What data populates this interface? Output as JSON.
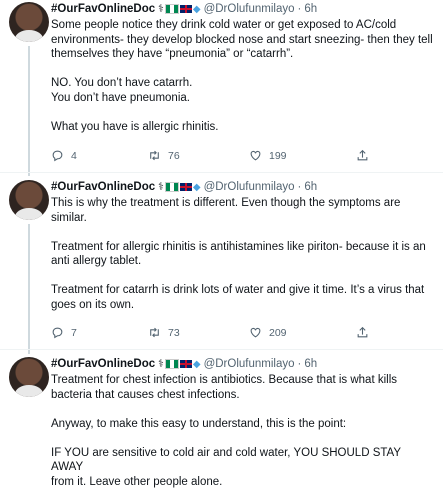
{
  "author": {
    "name": "#OurFavOnlineDoc",
    "handle": "@DrOlufunmilayo"
  },
  "tweets": [
    {
      "time": "6h",
      "lines": [
        "Some people notice they drink cold water or get exposed to AC/cold",
        "environments- they develop blocked nose and start sneezing- then they tell",
        "themselves they have “pneumonia” or “catarrh”.",
        "",
        "NO. You don’t have catarrh.",
        "You don’t have pneumonia.",
        "",
        "What you have is allergic rhinitis."
      ],
      "replies": "4",
      "retweets": "76",
      "likes": "199"
    },
    {
      "time": "6h",
      "lines": [
        "This is why the treatment is different. Even though the symptoms are",
        "similar.",
        "",
        "Treatment for allergic rhinitis is antihistamines like piriton- because it is an",
        "anti allergy tablet.",
        "",
        "Treatment for catarrh is drink lots of water and give it time. It’s a virus that",
        "goes on its own."
      ],
      "replies": "7",
      "retweets": "73",
      "likes": "209"
    },
    {
      "time": "6h",
      "lines": [
        "Treatment for chest infection is antibiotics. Because that is what kills",
        "bacteria that causes chest infections.",
        "",
        "Anyway, to make this easy to understand, this is the point:",
        "",
        "IF YOU are sensitive to cold air and cold water, YOU SHOULD STAY AWAY",
        "from it. Leave other people alone."
      ]
    }
  ]
}
